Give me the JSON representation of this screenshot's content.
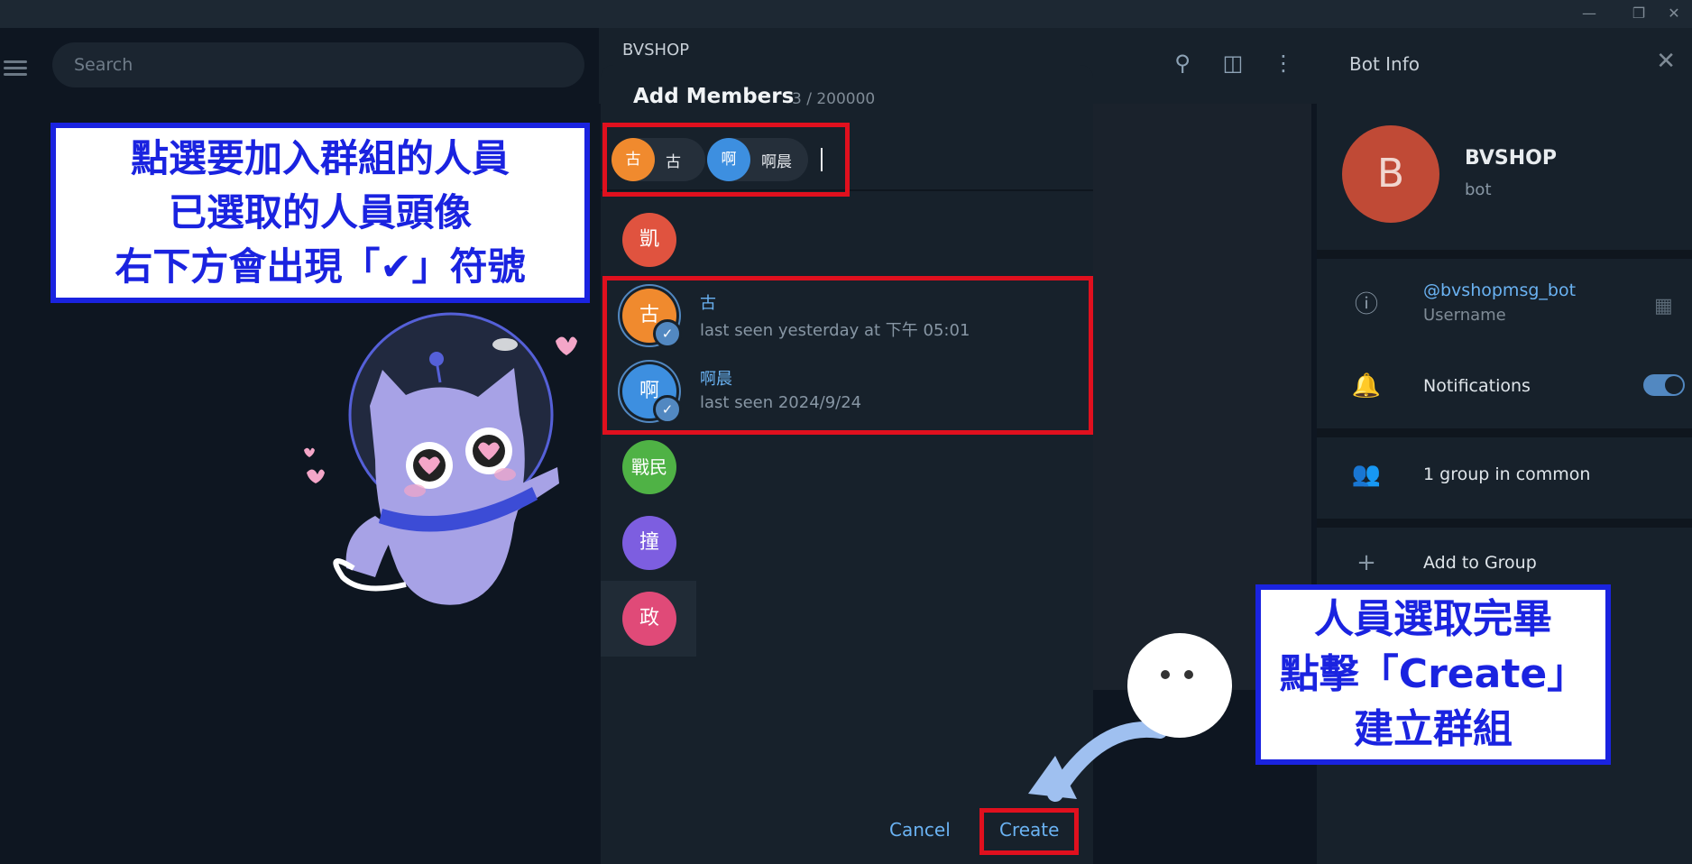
{
  "titlebar": {
    "minimize": "—",
    "restore": "❐",
    "close": "✕"
  },
  "left": {
    "search_placeholder": "Search"
  },
  "chat": {
    "title": "BVSHOP"
  },
  "modal": {
    "title": "Add Members",
    "count": "3 / 200000",
    "chips": [
      {
        "avatar": "古",
        "name": "古",
        "color": "#f08a2e"
      },
      {
        "avatar": "啊",
        "name": "啊晨",
        "color": "#3d8fe0"
      }
    ],
    "contacts": [
      {
        "avatar": "凱",
        "name": "",
        "status": "",
        "color": "#e0533f"
      },
      {
        "avatar": "古",
        "name": "古",
        "status": "last seen yesterday at 下午 05:01",
        "color": "#f08a2e"
      },
      {
        "avatar": "啊",
        "name": "啊晨",
        "status": "last seen 2024/9/24",
        "color": "#3d8fe0"
      },
      {
        "avatar": "戰民",
        "name": "",
        "status": "",
        "color": "#4fb245"
      },
      {
        "avatar": "撞",
        "name": "",
        "status": "",
        "color": "#7d5ee0"
      },
      {
        "avatar": "政",
        "name": "",
        "status": "",
        "color": "#e04a78"
      }
    ],
    "check": "✓",
    "cancel": "Cancel",
    "create": "Create"
  },
  "bot": {
    "panel_title": "Bot Info",
    "avatar": "B",
    "name": "BVSHOP",
    "sub": "bot",
    "username": "@bvshopmsg_bot",
    "username_label": "Username",
    "notifications": "Notifications",
    "groups": "1 group in common",
    "add_group": "Add to Group"
  },
  "annotations": {
    "note1": [
      "點選要加入群組的人員",
      "已選取的人員頭像",
      "右下方會出現「✔」符號"
    ],
    "note2": [
      "人員選取完畢",
      "點擊「Create」",
      "建立群組"
    ]
  },
  "colors": {
    "accent": "#6ab2f2",
    "highlight_red": "#e0101e",
    "note_blue": "#1a23e0"
  }
}
